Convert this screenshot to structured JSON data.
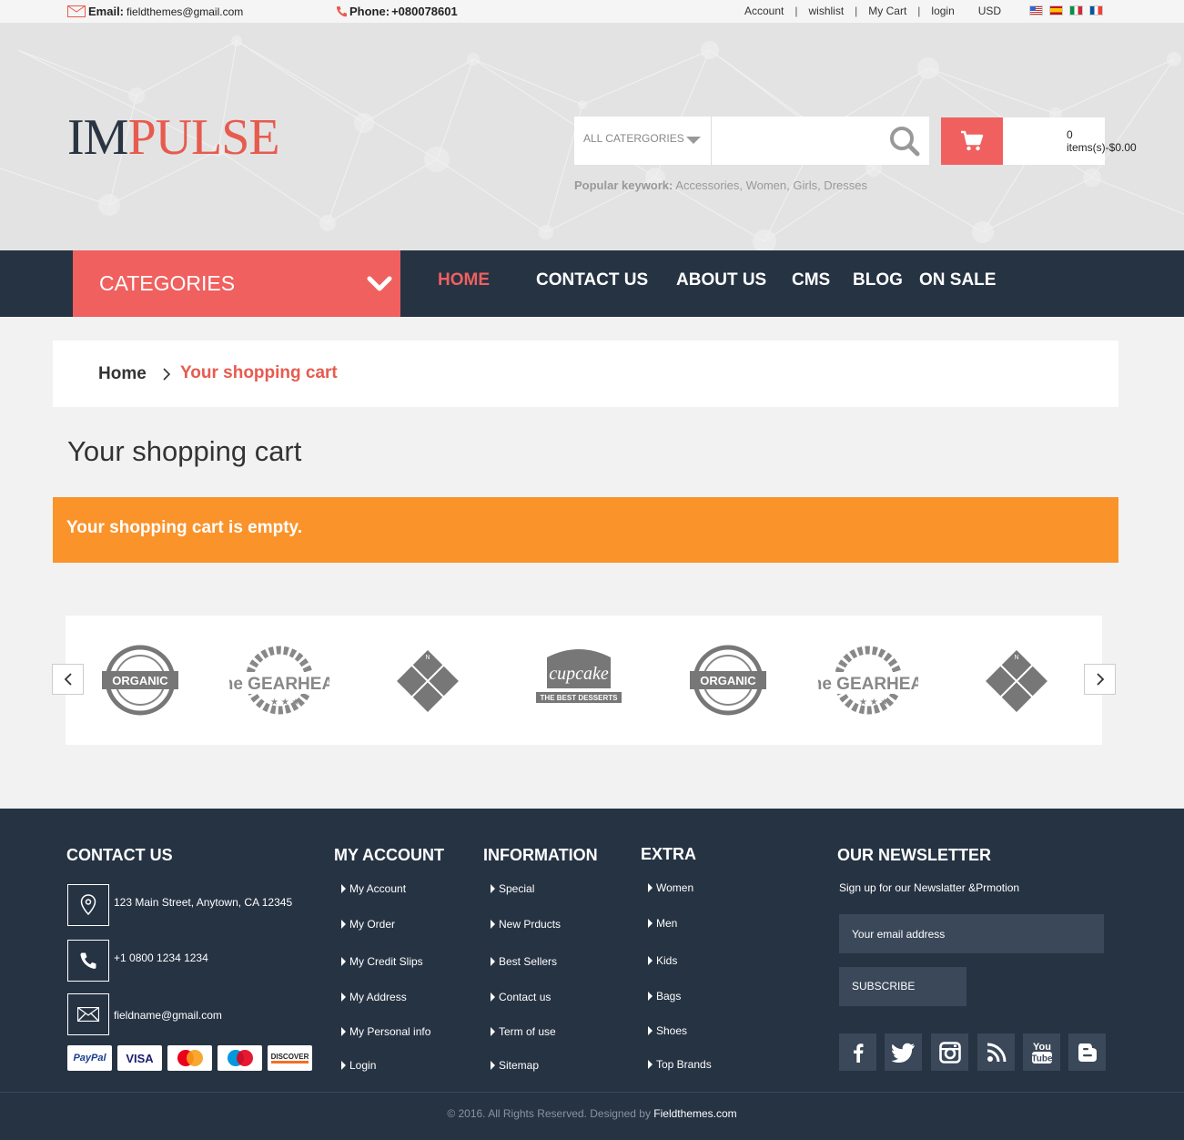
{
  "topbar": {
    "email_label": "Email:",
    "email_value": "fieldthemes@gmail.com",
    "phone_label": "Phone:",
    "phone_value": "+080078601",
    "links": [
      "Account",
      "wishlist",
      "My Cart",
      "login"
    ],
    "currency": "USD"
  },
  "header": {
    "logo_part1": "IM",
    "logo_part2": "PULSE",
    "category_select": "ALL CATERGORIES",
    "search_placeholder": "",
    "cart_summary": "0 items(s)-$0.00",
    "popular_label": "Popular keywork:",
    "popular_keywords": "Accessories, Women, Girls, Dresses"
  },
  "nav": {
    "categories_label": "CATEGORIES",
    "items": [
      "HOME",
      "CONTACT US",
      "ABOUT US",
      "CMS",
      "BLOG",
      "ON SALE"
    ]
  },
  "breadcrumb": {
    "home": "Home",
    "current": "Your shopping cart"
  },
  "page": {
    "title": "Your shopping cart",
    "empty_message": "Your shopping cart is empty."
  },
  "brands": [
    "ORGANIC",
    "The GEARHEAD",
    "compass",
    "cupcake",
    "ORGANIC",
    "The GEARHEAD",
    "compass"
  ],
  "footer": {
    "contact": {
      "heading": "CONTACT US",
      "address": "123 Main Street, Anytown, CA 12345",
      "phone": "+1 0800 1234 1234",
      "email": "fieldname@gmail.com"
    },
    "my_account": {
      "heading": "MY ACCOUNT",
      "items": [
        "My Account",
        "My Order",
        "My Credit Slips",
        "My Address",
        "My Personal info",
        "Login"
      ]
    },
    "information": {
      "heading": "INFORMATION",
      "items": [
        "Special",
        "New Prducts",
        "Best Sellers",
        "Contact us",
        "Term of use",
        "Sitemap"
      ]
    },
    "extra": {
      "heading": "EXTRA",
      "items": [
        "Women",
        "Men",
        "Kids",
        "Bags",
        "Shoes",
        "Top Brands"
      ]
    },
    "newsletter": {
      "heading": "OUR NEWSLETTER",
      "subtitle": "Sign up for our Newslatter &Prmotion",
      "placeholder": "Your email address",
      "button": "SUBSCRIBE"
    },
    "payment_cards": [
      "PayPal",
      "VISA",
      "MasterCard",
      "Maestro",
      "DISCOVER"
    ],
    "social_icons": [
      "facebook-icon",
      "twitter-icon",
      "instagram-icon",
      "rss-icon",
      "youtube-icon",
      "blogger-icon"
    ],
    "copyright": "© 2016. All Rights Reserved. Designed by",
    "designer": "Fieldthemes.com"
  },
  "colors": {
    "accent": "#f0605f",
    "dark": "#263343",
    "alert": "#fb932b"
  }
}
